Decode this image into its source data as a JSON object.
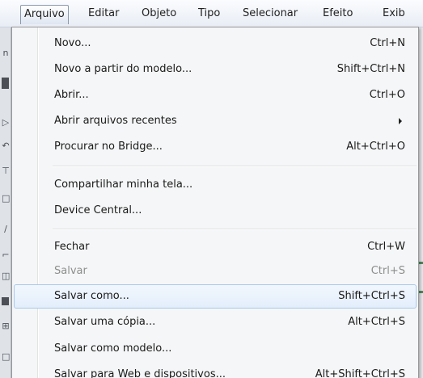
{
  "menubar": {
    "items": [
      {
        "label": "Arquivo",
        "active": true
      },
      {
        "label": "Editar"
      },
      {
        "label": "Objeto"
      },
      {
        "label": "Tipo"
      },
      {
        "label": "Selecionar"
      },
      {
        "label": "Efeito"
      },
      {
        "label": "Exib"
      }
    ]
  },
  "menu": {
    "items": [
      {
        "label": "Novo...",
        "shortcut": "Ctrl+N"
      },
      {
        "label": "Novo a partir do modelo...",
        "shortcut": "Shift+Ctrl+N"
      },
      {
        "label": "Abrir...",
        "shortcut": "Ctrl+O"
      },
      {
        "label": "Abrir arquivos recentes",
        "shortcut": "",
        "submenu": true
      },
      {
        "label": "Procurar no Bridge...",
        "shortcut": "Alt+Ctrl+O"
      },
      {
        "label": "Compartilhar minha tela...",
        "shortcut": ""
      },
      {
        "label": "Device Central...",
        "shortcut": ""
      },
      {
        "label": "Fechar",
        "shortcut": "Ctrl+W"
      },
      {
        "label": "Salvar",
        "shortcut": "Ctrl+S",
        "disabled": true
      },
      {
        "label": "Salvar como...",
        "shortcut": "Shift+Ctrl+S",
        "highlighted": true
      },
      {
        "label": "Salvar uma cópia...",
        "shortcut": "Alt+Ctrl+S"
      },
      {
        "label": "Salvar como modelo...",
        "shortcut": ""
      },
      {
        "label": "Salvar para Web e dispositivos...",
        "shortcut": "Alt+Shift+Ctrl+S"
      }
    ]
  },
  "icons": {
    "submenu_arrow": "chevron-right-icon"
  },
  "colors": {
    "highlight_border": "#a8c8ec",
    "highlight_fill": "#e3eefb",
    "menu_background": "#f5f6f7",
    "disabled_text": "#8d8d8d"
  }
}
